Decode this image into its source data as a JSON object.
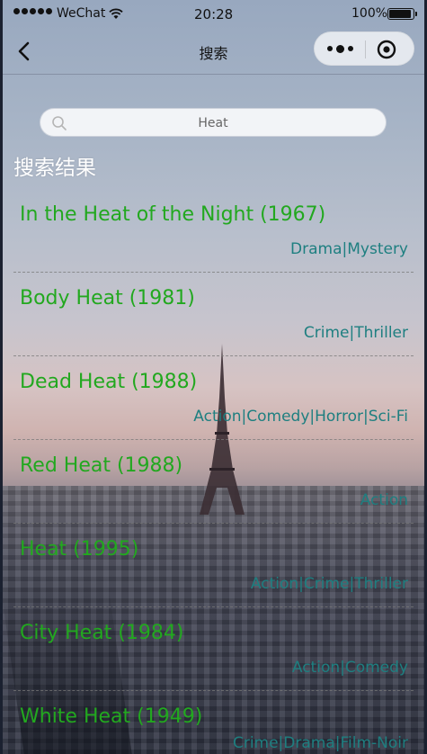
{
  "status_bar": {
    "carrier": "WeChat",
    "time": "20:28",
    "battery": "100%"
  },
  "nav": {
    "title": "搜索",
    "back_icon": "chevron-left-icon",
    "more_icon": "more-dots-icon",
    "close_icon": "target-circle-icon"
  },
  "search": {
    "value": "Heat",
    "icon": "search-icon"
  },
  "section_title": "搜索结果",
  "colors": {
    "title_green": "#22a81f",
    "genre_teal": "#1e7f80"
  },
  "results": [
    {
      "title": "In the Heat of the Night (1967)",
      "genres": "Drama|Mystery"
    },
    {
      "title": "Body Heat (1981)",
      "genres": "Crime|Thriller"
    },
    {
      "title": "Dead Heat (1988)",
      "genres": "Action|Comedy|Horror|Sci-Fi"
    },
    {
      "title": "Red Heat (1988)",
      "genres": "Action"
    },
    {
      "title": "Heat (1995)",
      "genres": "Action|Crime|Thriller"
    },
    {
      "title": "City Heat (1984)",
      "genres": "Action|Comedy"
    },
    {
      "title": "White Heat (1949)",
      "genres": "Crime|Drama|Film-Noir"
    }
  ]
}
